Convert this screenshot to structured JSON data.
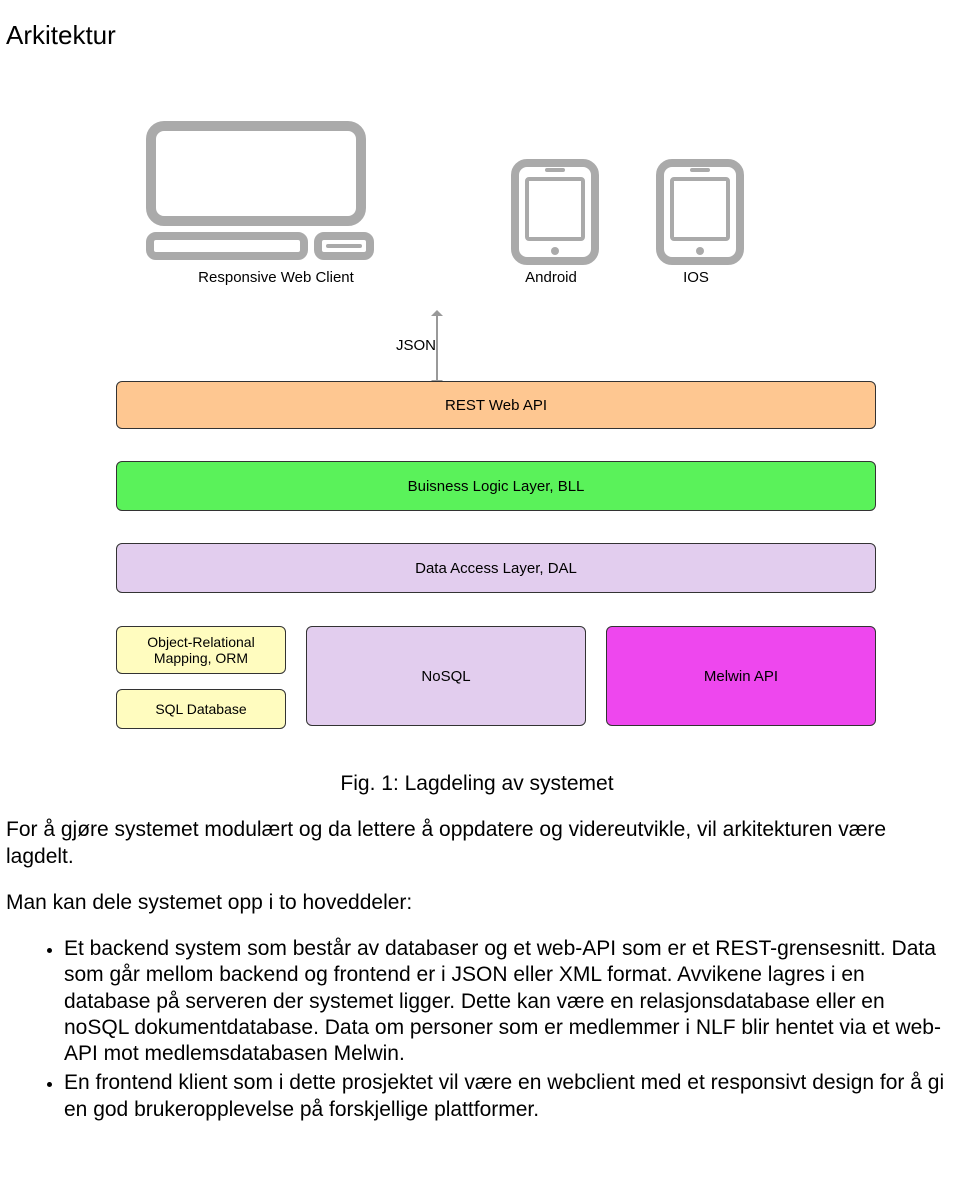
{
  "title": "Arkitektur",
  "diagram": {
    "clients": {
      "web": {
        "label": "Responsive Web Client"
      },
      "android": {
        "label": "Android"
      },
      "ios": {
        "label": "IOS"
      }
    },
    "json_label": "JSON",
    "layers": {
      "rest": "REST Web API",
      "bll": "Buisness Logic Layer, BLL",
      "dal": "Data Access Layer, DAL",
      "orm": "Object-Relational Mapping, ORM",
      "sqldb": "SQL Database",
      "nosql": "NoSQL",
      "melwin": "Melwin API"
    }
  },
  "caption": "Fig. 1: Lagdeling av systemet",
  "para1": "For å gjøre systemet modulært og da lettere å oppdatere og videreutvikle, vil arkitekturen være lagdelt.",
  "para2": "Man kan dele systemet opp i to hoveddeler:",
  "bullets": [
    "Et backend system som består av databaser og et web-API som er et REST-grensesnitt. Data som går mellom backend og frontend er i JSON eller XML format. Avvikene lagres i en database på serveren der systemet ligger. Dette kan være en relasjonsdatabase eller en noSQL dokumentdatabase. Data om personer som er medlemmer i NLF blir hentet via et web-API mot medlemsdatabasen Melwin.",
    "En frontend klient som i dette prosjektet vil være en webclient med et responsivt design for å gi en god brukeropplevelse på forskjellige plattformer."
  ]
}
